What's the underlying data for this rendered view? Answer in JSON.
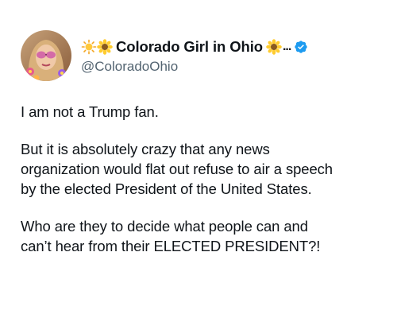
{
  "tweet": {
    "author": {
      "display_name": "Colorado Girl in Ohio",
      "handle": "@ColoradoOhio",
      "ellipsis": "...",
      "verified": true,
      "name_prefix_icons": [
        "sun-emoji-icon",
        "sunflower-emoji-icon"
      ],
      "name_suffix_icons": [
        "sunflower-emoji-icon"
      ]
    },
    "paragraphs": [
      "I am not a Trump fan.",
      "But it is absolutely crazy that any news\norganization would flat out refuse to air a speech\nby the elected President of the United States.",
      "Who are they to decide what people can and\ncan’t hear from their ELECTED PRESIDENT?!"
    ]
  },
  "colors": {
    "text": "#0f1419",
    "handle": "#536471",
    "verified_badge": "#1d9bf0",
    "background": "#ffffff"
  }
}
